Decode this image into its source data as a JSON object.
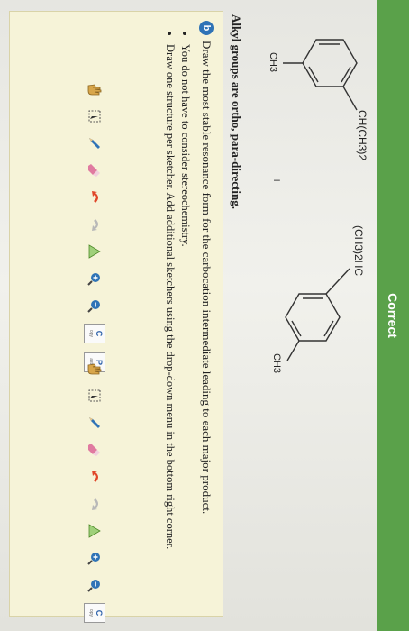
{
  "status": {
    "label": "Correct"
  },
  "molecule_ortho": {
    "substituent_top": "CH(CH3)2",
    "substituent_bottom": "CH3"
  },
  "molecule_para": {
    "substituent_top": "(CH3)2HC",
    "substituent_bottom": "CH3"
  },
  "plus_sign": "+",
  "note": "Alkyl groups are ortho, para-directing.",
  "question": {
    "badge": "b",
    "text": "Draw the most stable resonance form for the carbocation intermediate leading to each major product."
  },
  "bullets": [
    "You do not have to consider stereochemistry.",
    "Draw one structure per sketcher. Add additional sketchers using the drop-down menu in the bottom right corner."
  ],
  "toolbar": {
    "copy_label": "C",
    "copy_sub": "opy",
    "paste_label": "P",
    "paste_sub": "aste",
    "icons": [
      "hand-icon",
      "lasso-icon",
      "pencil-icon",
      "eraser-icon",
      "undo-icon",
      "redo-icon",
      "template-icon",
      "zoom-in-icon",
      "zoom-out-icon"
    ]
  },
  "colors": {
    "correct_bar": "#5aa14a",
    "badge": "#2f73b6",
    "instruction_bg": "#f6f3d8"
  }
}
